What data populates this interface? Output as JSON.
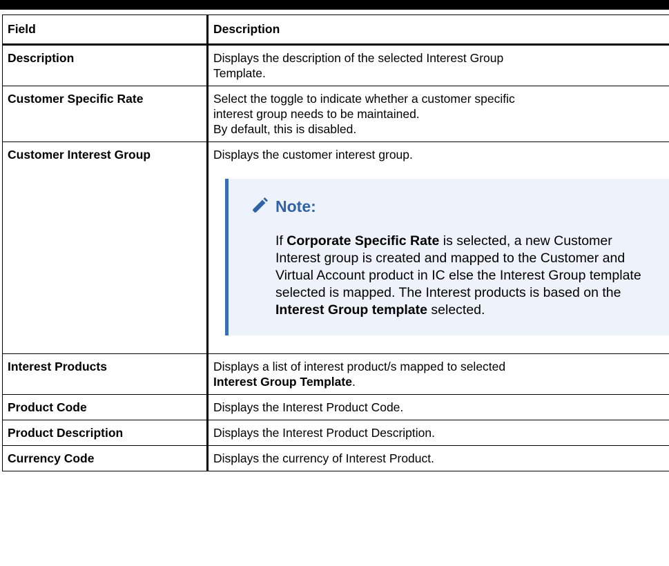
{
  "table": {
    "headers": [
      "Field",
      "Description"
    ],
    "rows": [
      {
        "field": "Description",
        "lines": [
          "Displays the description of the selected Interest Group",
          "Template."
        ]
      },
      {
        "field": "Customer Specific Rate",
        "lines": [
          "Select the toggle to indicate whether a customer specific",
          "interest group needs to be maintained.",
          "By default, this is disabled."
        ]
      },
      {
        "field": "Customer Interest Group",
        "lines": [
          "Displays the customer interest group."
        ],
        "note": {
          "title": "Note:",
          "icon": "pencil-icon",
          "p1_a": "If ",
          "p1_b": "Corporate Specific Rate",
          "p1_c": " is selected, a new Customer Interest group is created and mapped to the Customer and Virtual Account product in IC else the Interest Group template selected is mapped. The Interest products is based on the ",
          "p1_d": "Interest Group template",
          "p1_e": " selected."
        }
      },
      {
        "field": "Interest Products",
        "line1": "Displays a list of interest product/s mapped to selected",
        "line2_bold": "Interest Group Template",
        "line2_end": "."
      },
      {
        "field": "Product Code",
        "lines": [
          "Displays the Interest Product Code."
        ]
      },
      {
        "field": "Product Description",
        "lines": [
          "Displays the Interest Product Description."
        ]
      },
      {
        "field": "Currency Code",
        "lines": [
          "Displays the currency of Interest Product."
        ]
      }
    ]
  },
  "colors": {
    "note_accent": "#3d6db5",
    "note_title": "#3062a8",
    "note_bg": "#eef3fb"
  }
}
